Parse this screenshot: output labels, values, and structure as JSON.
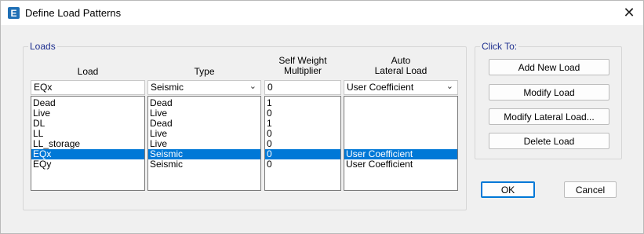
{
  "window": {
    "title": "Define Load Patterns",
    "icon_letter": "E",
    "close_glyph": "✕"
  },
  "loads_group": {
    "legend": "Loads",
    "headers": {
      "load": "Load",
      "type": "Type",
      "self_weight": [
        "Self Weight",
        "Multiplier"
      ],
      "auto_lateral": [
        "Auto",
        "Lateral Load"
      ]
    },
    "edit_row": {
      "load": "EQx",
      "type": "Seismic",
      "self_weight": "0",
      "auto_lateral": "User Coefficient"
    },
    "rows": [
      {
        "load": "Dead",
        "type": "Dead",
        "multiplier": "1",
        "lateral": ""
      },
      {
        "load": "Live",
        "type": "Live",
        "multiplier": "0",
        "lateral": ""
      },
      {
        "load": "DL",
        "type": "Dead",
        "multiplier": "1",
        "lateral": ""
      },
      {
        "load": "LL",
        "type": "Live",
        "multiplier": "0",
        "lateral": ""
      },
      {
        "load": "LL_storage",
        "type": "Live",
        "multiplier": "0",
        "lateral": ""
      },
      {
        "load": "EQx",
        "type": "Seismic",
        "multiplier": "0",
        "lateral": "User Coefficient",
        "selected": true
      },
      {
        "load": "EQy",
        "type": "Seismic",
        "multiplier": "0",
        "lateral": "User Coefficient"
      }
    ]
  },
  "click_to_group": {
    "legend": "Click To:",
    "buttons": {
      "add_new_load": "Add New Load",
      "modify_load": "Modify Load",
      "modify_lateral_load": "Modify Lateral Load...",
      "delete_load": "Delete Load"
    }
  },
  "footer": {
    "ok": "OK",
    "cancel": "Cancel"
  },
  "colors": {
    "selection": "#0078d7",
    "legend_text": "#1e2f8f",
    "app_icon": "#1f6fb5"
  }
}
